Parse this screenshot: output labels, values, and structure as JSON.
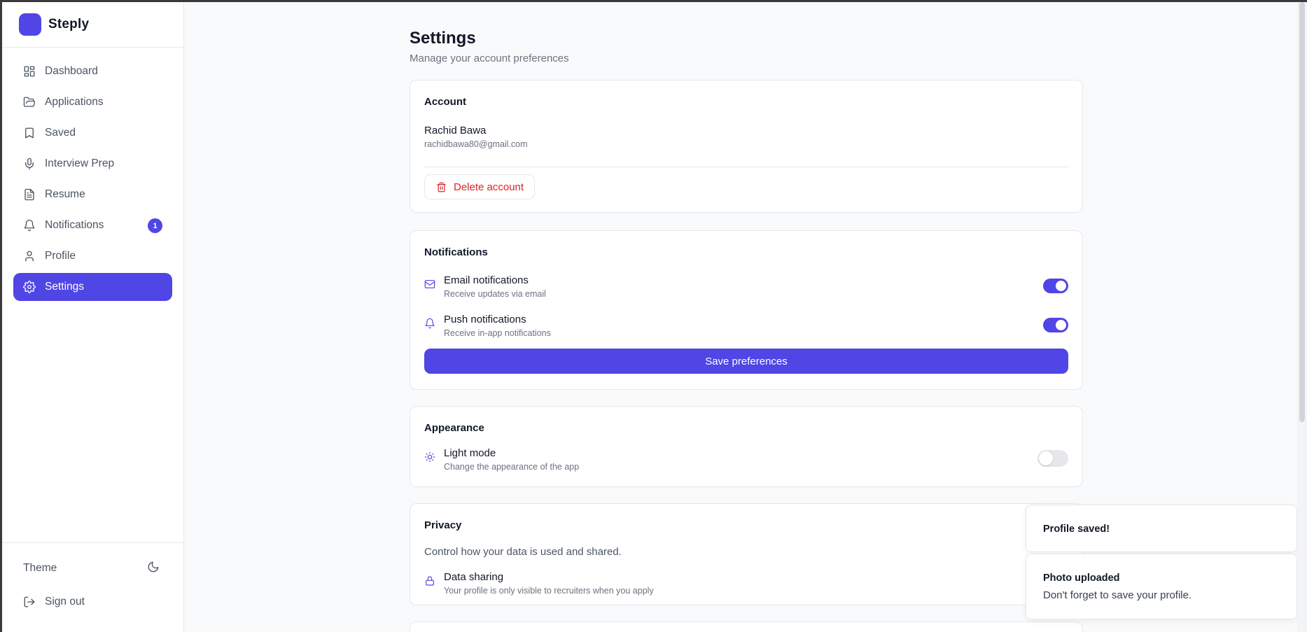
{
  "app": {
    "name": "Steply",
    "brand_color": "#4f46e5"
  },
  "sidebar": {
    "items": [
      {
        "label": "Dashboard",
        "icon": "dashboard-icon"
      },
      {
        "label": "Applications",
        "icon": "folder-open-icon"
      },
      {
        "label": "Saved",
        "icon": "bookmark-icon"
      },
      {
        "label": "Interview Prep",
        "icon": "microphone-icon"
      },
      {
        "label": "Resume",
        "icon": "file-text-icon"
      },
      {
        "label": "Notifications",
        "icon": "bell-icon",
        "badge": "1"
      },
      {
        "label": "Profile",
        "icon": "user-icon"
      },
      {
        "label": "Settings",
        "icon": "gear-icon",
        "active": true
      }
    ],
    "theme_label": "Theme",
    "signout_label": "Sign out"
  },
  "page": {
    "title": "Settings",
    "subtitle": "Manage your account preferences"
  },
  "account": {
    "title": "Account",
    "name": "Rachid Bawa",
    "email": "rachidbawa80@gmail.com",
    "delete_label": "Delete account"
  },
  "notifications": {
    "title": "Notifications",
    "email": {
      "label": "Email notifications",
      "desc": "Receive updates via email",
      "enabled": true
    },
    "push": {
      "label": "Push notifications",
      "desc": "Receive in-app notifications",
      "enabled": true
    },
    "save_label": "Save preferences"
  },
  "appearance": {
    "title": "Appearance",
    "light": {
      "label": "Light mode",
      "desc": "Change the appearance of the app",
      "enabled": false
    }
  },
  "privacy": {
    "title": "Privacy",
    "desc": "Control how your data is used and shared.",
    "sharing": {
      "label": "Data sharing",
      "desc": "Your profile is only visible to recruiters when you apply"
    }
  },
  "toasts": [
    {
      "title": "Profile saved!"
    },
    {
      "title": "Photo uploaded",
      "desc": "Don't forget to save your profile."
    }
  ]
}
